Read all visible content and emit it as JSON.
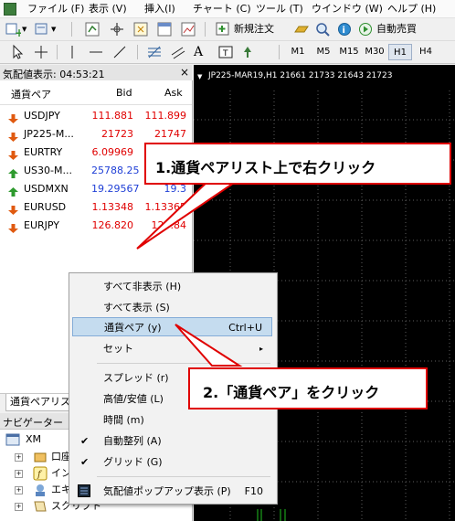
{
  "menubar": {
    "items": [
      "ファイル (F)",
      "表示 (V)",
      "挿入(I)",
      "チャート (C)",
      "ツール (T)",
      "ウインドウ (W)",
      "ヘルプ (H)"
    ]
  },
  "toolbar": {
    "new_order": "新規注文",
    "auto_trade": "自動売買"
  },
  "timeframes": [
    "M1",
    "M5",
    "M15",
    "M30",
    "H1",
    "H4"
  ],
  "timeframe_selected": "H1",
  "market_watch": {
    "title": "気配値表示: 04:53:21",
    "close": "×",
    "columns": {
      "symbol": "通貨ペア",
      "bid": "Bid",
      "ask": "Ask"
    },
    "rows": [
      {
        "symbol": "USDJPY",
        "bid": "111.881",
        "ask": "111.899",
        "dir": "down"
      },
      {
        "symbol": "JP225-M...",
        "bid": "21723",
        "ask": "21747",
        "dir": "down"
      },
      {
        "symbol": "EURTRY",
        "bid": "6.09969",
        "ask": "6.1",
        "dir": "down"
      },
      {
        "symbol": "US30-M...",
        "bid": "25788.25",
        "ask": "2",
        "dir": "up"
      },
      {
        "symbol": "USDMXN",
        "bid": "19.29567",
        "ask": "19.3",
        "dir": "up"
      },
      {
        "symbol": "EURUSD",
        "bid": "1.13348",
        "ask": "1.13365",
        "dir": "down"
      },
      {
        "symbol": "EURJPY",
        "bid": "126.820",
        "ask": "126.84",
        "dir": "down"
      }
    ],
    "tab_label": "通貨ペアリス"
  },
  "navigator": {
    "title": "ナビゲーター",
    "close": "×",
    "items": [
      "XM",
      "口座",
      "インデ",
      "エキス",
      "スクリプト"
    ]
  },
  "chart": {
    "header": "JP225-MAR19,H1  21661 21733 21643 21723"
  },
  "context_menu": {
    "items": [
      {
        "label": "すべて非表示 (H)",
        "shortcut": ""
      },
      {
        "label": "すべて表示 (S)",
        "shortcut": ""
      },
      {
        "label": "通貨ペア (y)",
        "shortcut": "Ctrl+U"
      },
      {
        "label": "セット",
        "shortcut": "▸"
      },
      {
        "label": "スプレッド (r)",
        "shortcut": ""
      },
      {
        "label": "高値/安値 (L)",
        "shortcut": ""
      },
      {
        "label": "時間 (m)",
        "shortcut": ""
      },
      {
        "label": "自動整列 (A)",
        "shortcut": ""
      },
      {
        "label": "グリッド (G)",
        "shortcut": ""
      },
      {
        "label": "気配値ポップアップ表示 (P)",
        "shortcut": "F10"
      }
    ],
    "checkmark": "✔"
  },
  "callouts": {
    "step1": "1.通貨ペアリスト上で右クリック",
    "step2": "2.「通貨ペア」をクリック"
  },
  "colors": {
    "accent_red": "#e00000",
    "bid_down": "#e00000",
    "bid_up": "#1f3fd6",
    "chart_bg": "#000000",
    "grid": "#5e5e5e"
  }
}
